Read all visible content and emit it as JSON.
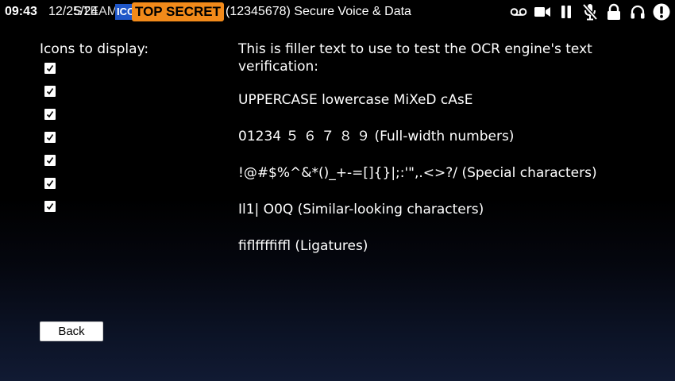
{
  "status_bar": {
    "time": "09:43",
    "date": "12/25/24",
    "date_overlap": "STEAM",
    "icc_badge": "ICC",
    "classification": "TOP SECRET",
    "classification_color": "#f28a1a",
    "info": "(12345678) Secure Voice & Data",
    "icons": [
      "voicemail-icon",
      "video-camera-icon",
      "pause-icon",
      "mic-off-icon",
      "lock-icon",
      "headphones-icon",
      "alert-icon"
    ]
  },
  "left_panel": {
    "heading": "Icons to display:",
    "checkboxes": [
      {
        "checked": true
      },
      {
        "checked": true
      },
      {
        "checked": true
      },
      {
        "checked": true
      },
      {
        "checked": true
      },
      {
        "checked": true
      },
      {
        "checked": true
      }
    ]
  },
  "content": {
    "intro": "This is filler text to use to test the OCR engine's text verification:",
    "case_line": "UPPERCASE lowercase MiXeD cAsE",
    "numbers_line": "01234 ５ ６ ７ ８ ９ (Full-width numbers)",
    "special_line": "!@#$%^&*()_+-=[]{}|;:'\",.<>?/ (Special characters)",
    "similar_line": "Il1| O0Q (Similar-looking characters)",
    "ligature_line": "ﬁﬂﬀﬃﬄ (Ligatures)"
  },
  "buttons": {
    "back": "Back"
  }
}
